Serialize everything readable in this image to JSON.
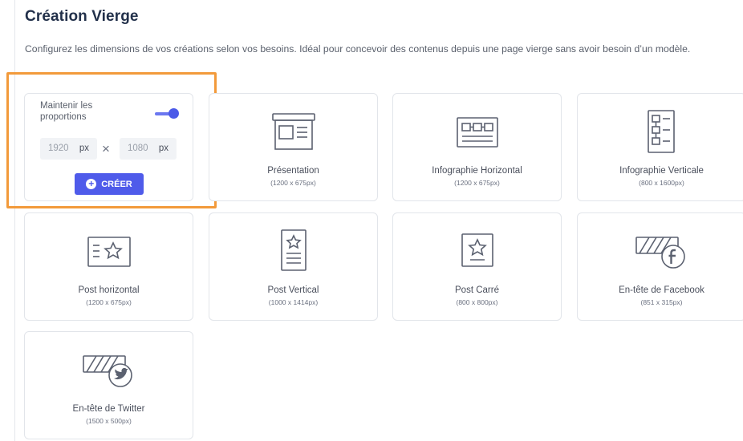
{
  "header": {
    "title": "Création Vierge",
    "description": "Configurez les dimensions de vos créations selon vos besoins. Idéal pour concevoir des contenus depuis une page vierge sans avoir besoin d’un modèle."
  },
  "custom": {
    "keep_proportions_label": "Maintenir les proportions",
    "keep_proportions_on": true,
    "width_value": "1920",
    "height_value": "1080",
    "unit": "px",
    "times_symbol": "×",
    "create_label": "CRÉER"
  },
  "formats": [
    {
      "name": "Présentation",
      "dims": "(1200 x 675px)",
      "icon": "presentation-icon"
    },
    {
      "name": "Infographie Horizontal",
      "dims": "(1200 x 675px)",
      "icon": "infographic-horizontal-icon"
    },
    {
      "name": "Infographie Verticale",
      "dims": "(800 x 1600px)",
      "icon": "infographic-vertical-icon"
    },
    {
      "name": "Post horizontal",
      "dims": "(1200 x 675px)",
      "icon": "post-horizontal-icon"
    },
    {
      "name": "Post Vertical",
      "dims": "(1000 x 1414px)",
      "icon": "post-vertical-icon"
    },
    {
      "name": "Post Carré",
      "dims": "(800 x 800px)",
      "icon": "post-square-icon"
    },
    {
      "name": "En-tête de Facebook",
      "dims": "(851 x 315px)",
      "icon": "facebook-header-icon"
    },
    {
      "name": "En-tête de Twitter",
      "dims": "(1500 x 500px)",
      "icon": "twitter-header-icon"
    }
  ],
  "colors": {
    "accent": "#4f5bea",
    "highlight": "#f29a3b",
    "title": "#22304a"
  }
}
